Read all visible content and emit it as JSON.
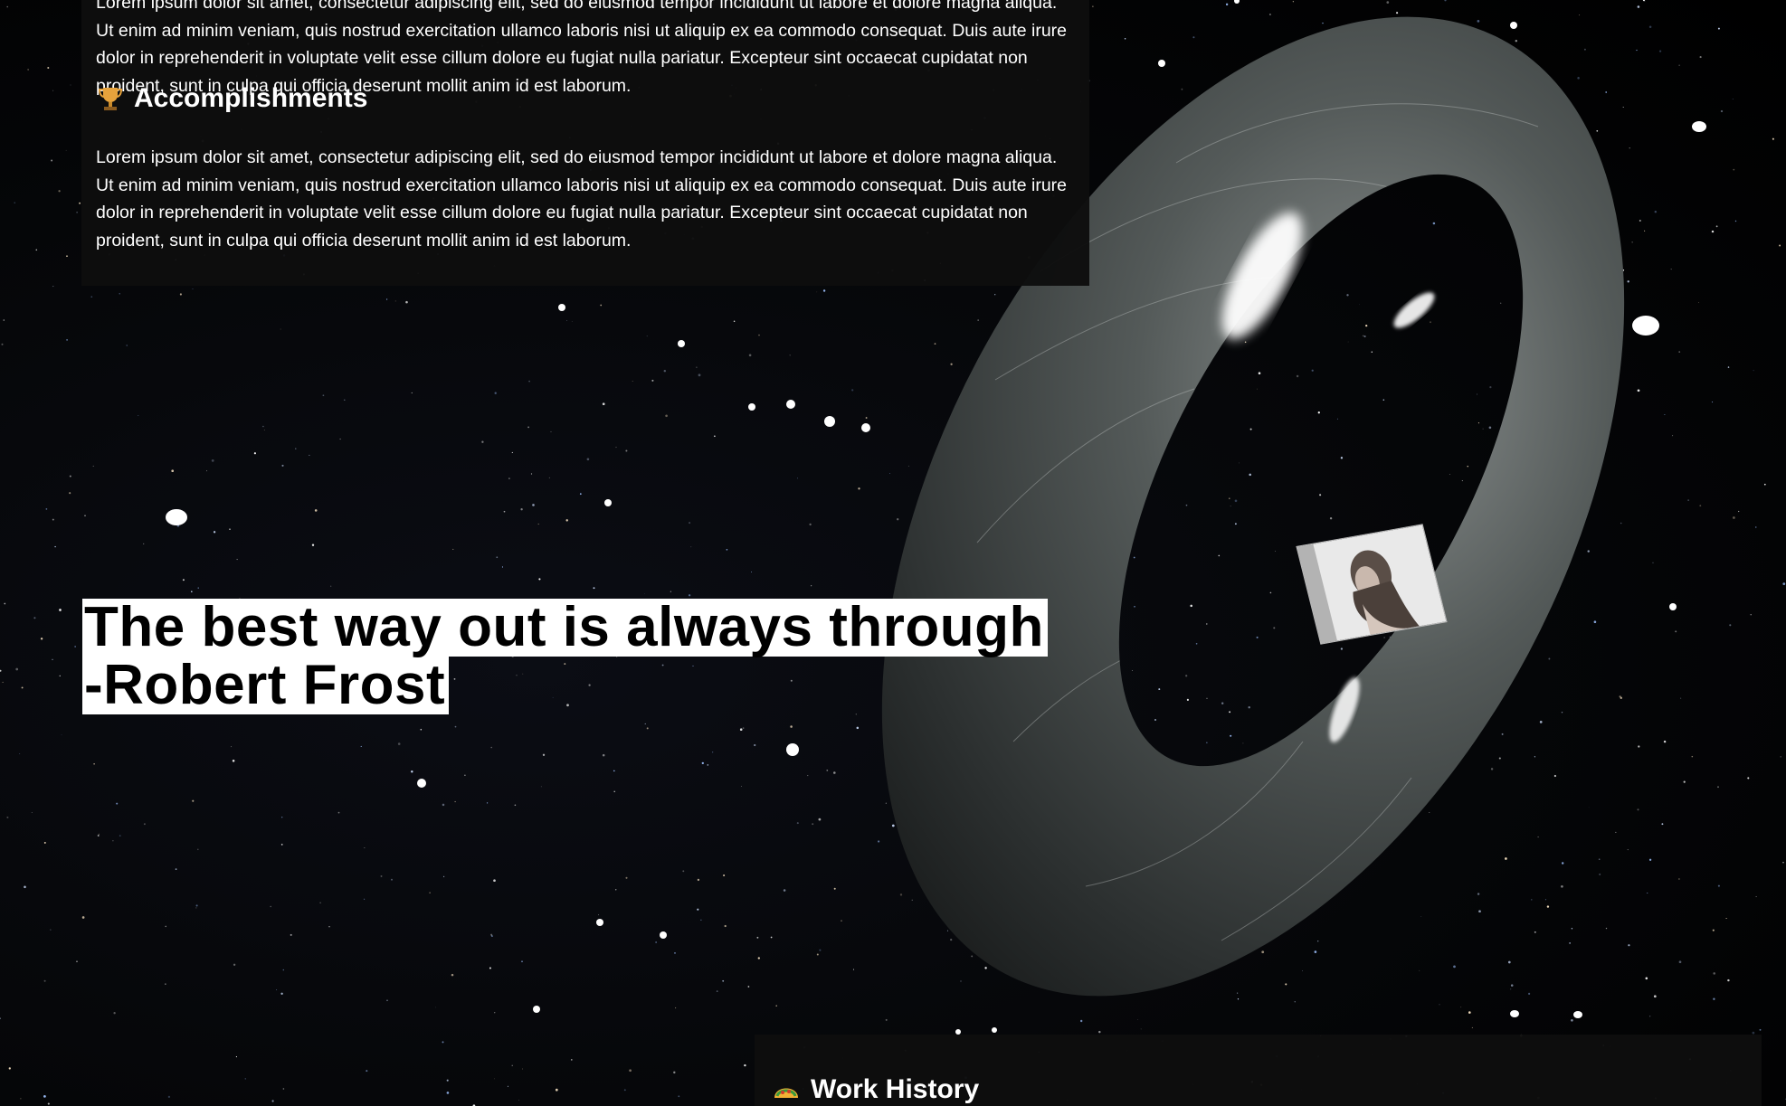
{
  "about": {
    "paragraph": "Lorem ipsum dolor sit amet, consectetur adipiscing elit, sed do eiusmod tempor incididunt ut labore et dolore magna aliqua. Ut enim ad minim veniam, quis nostrud exercitation ullamco laboris nisi ut aliquip ex ea commodo consequat. Duis aute irure dolor in reprehenderit in voluptate velit esse cillum dolore eu fugiat nulla pariatur. Excepteur sint occaecat cupidatat non proident, sunt in culpa qui officia deserunt mollit anim id est laborum."
  },
  "accomplishments": {
    "icon": "trophy-icon",
    "heading": "Accomplishments",
    "paragraph": "Lorem ipsum dolor sit amet, consectetur adipiscing elit, sed do eiusmod tempor incididunt ut labore et dolore magna aliqua. Ut enim ad minim veniam, quis nostrud exercitation ullamco laboris nisi ut aliquip ex ea commodo consequat. Duis aute irure dolor in reprehenderit in voluptate velit esse cillum dolore eu fugiat nulla pariatur. Excepteur sint occaecat cupidatat non proident, sunt in culpa qui officia deserunt mollit anim id est laborum."
  },
  "quote": {
    "line1": "The best way out is always through",
    "line2": "-Robert Frost"
  },
  "work_history": {
    "icon": "taco-icon",
    "heading": "Work History"
  },
  "colors": {
    "background": "#000000",
    "panel": "#0e0e0e",
    "text": "#ffffff",
    "quote_highlight": "#ffffff",
    "quote_text": "#000000"
  }
}
